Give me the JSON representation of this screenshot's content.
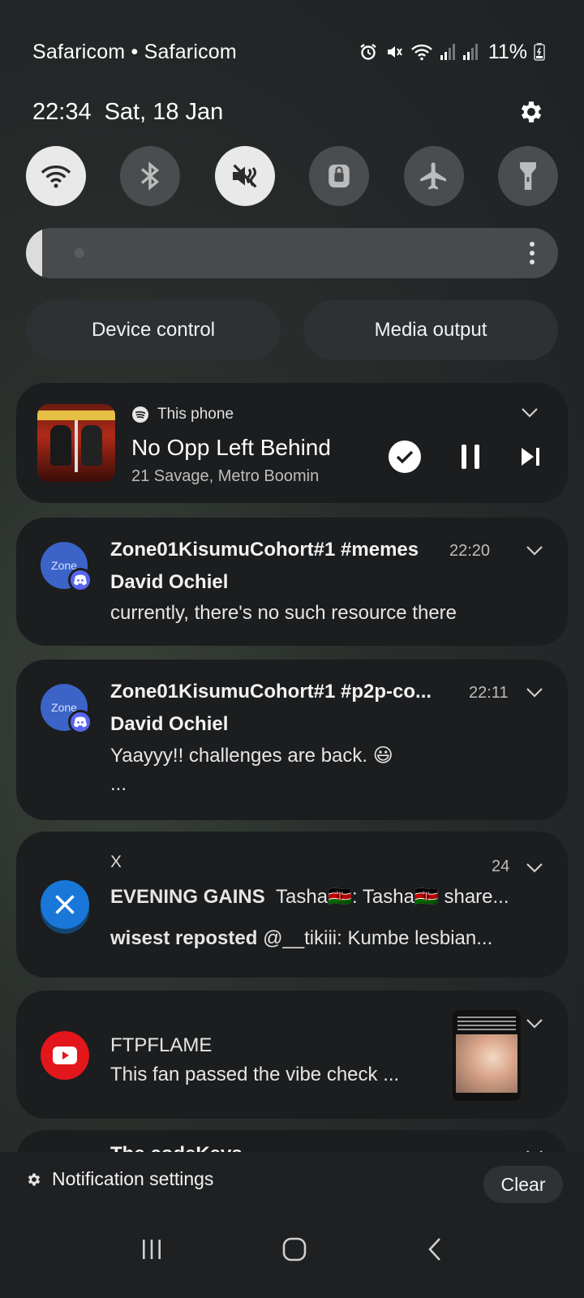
{
  "status_bar": {
    "carrier": "Safaricom • Safaricom",
    "battery": "11%",
    "icons": [
      "alarm-icon",
      "mute-icon",
      "wifi-icon",
      "signal-icon",
      "signal-icon",
      "battery-icon"
    ]
  },
  "header": {
    "time": "22:34",
    "date": "Sat, 18 Jan",
    "settings_icon": "gear-icon"
  },
  "quick_toggles": [
    {
      "name": "wifi",
      "icon": "wifi-icon",
      "on": true
    },
    {
      "name": "bluetooth",
      "icon": "bluetooth-icon",
      "on": false
    },
    {
      "name": "sound-mute",
      "icon": "mute-icon",
      "on": true
    },
    {
      "name": "rotation-lock",
      "icon": "lock-icon",
      "on": false
    },
    {
      "name": "airplane-mode",
      "icon": "airplane-icon",
      "on": false
    },
    {
      "name": "flashlight",
      "icon": "flashlight-icon",
      "on": false
    }
  ],
  "brightness": {
    "level": 0.03
  },
  "pills": {
    "device_control": "Device control",
    "media_output": "Media output"
  },
  "media": {
    "source": "This phone",
    "title": "No Opp Left Behind",
    "artist": "21 Savage, Metro Boomin"
  },
  "notifications": [
    {
      "title": "Zone01KisumuCohort#1 #memes",
      "time": "22:20",
      "sender": "David Ochiel",
      "text": "currently, there's no such resource there",
      "icon_text": "Zone"
    },
    {
      "title": "Zone01KisumuCohort#1 #p2p-co...",
      "time": "22:11",
      "sender": "David Ochiel",
      "text": "Yaayyy!! challenges are back. 😃",
      "extra": "...",
      "icon_text": "Zone"
    },
    {
      "app": "X",
      "count": "24",
      "line1_bold": "EVENING GAINS",
      "line1_text": "Tasha🇰🇪: Tasha🇰🇪 share...",
      "line2_bold": "wisest reposted",
      "line2_text": "@__tikiii: Kumbe lesbian..."
    },
    {
      "title": "FTPFLAME",
      "text": "This fan passed the vibe check ..."
    },
    {
      "title": "The codeKevs"
    }
  ],
  "footer": {
    "notification_settings": "Notification settings",
    "clear": "Clear"
  }
}
